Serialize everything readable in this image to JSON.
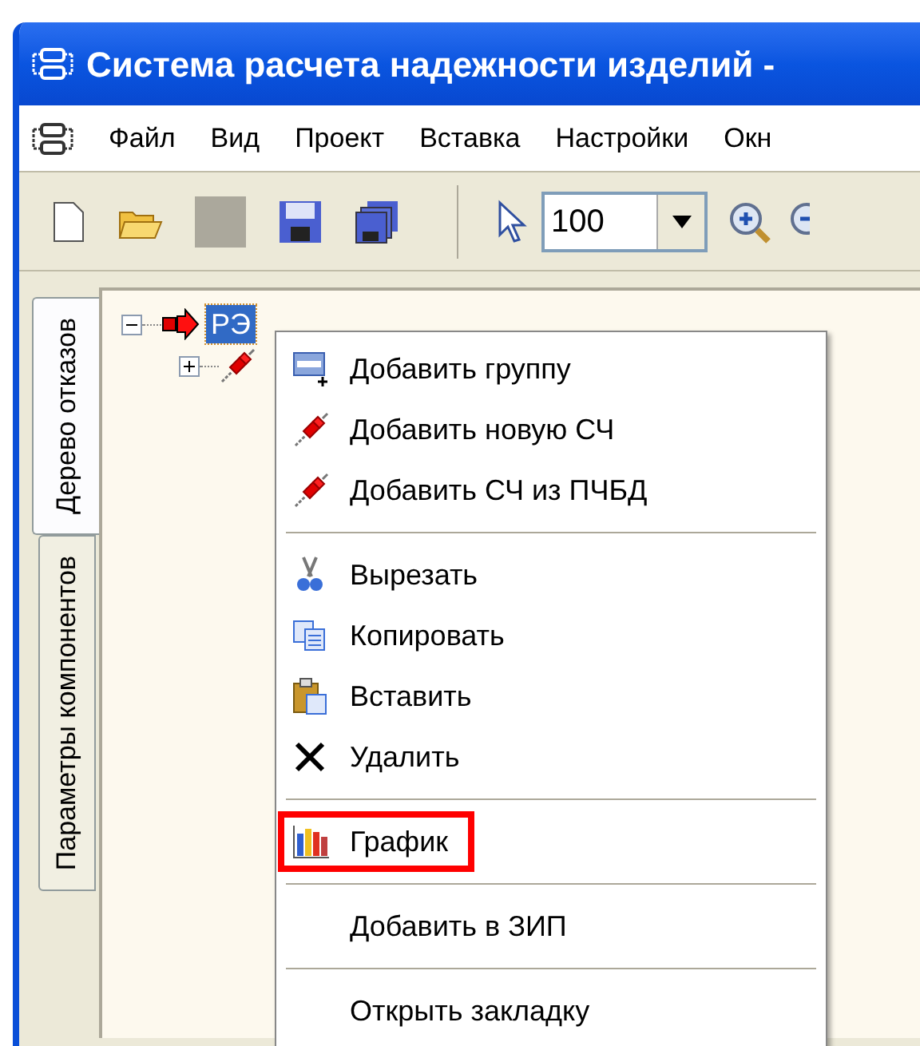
{
  "window": {
    "title": "Система расчета надежности изделий -"
  },
  "menu_bar": [
    "Файл",
    "Вид",
    "Проект",
    "Вставка",
    "Настройки",
    "Окн"
  ],
  "toolbar": {
    "zoom_value": "100"
  },
  "side_tabs": [
    {
      "label": "Дерево отказов",
      "selected": true
    },
    {
      "label": "Параметры компонентов",
      "selected": false
    }
  ],
  "tree": [
    {
      "label": "РЭ",
      "selected": true,
      "expanded": true,
      "children": [
        {
          "expanded": false
        }
      ]
    }
  ],
  "context_menu": {
    "groups": [
      [
        {
          "label": "Добавить группу",
          "highlighted": false
        },
        {
          "label": "Добавить новую СЧ",
          "highlighted": false
        },
        {
          "label": "Добавить СЧ из ПЧБД",
          "highlighted": false
        }
      ],
      [
        {
          "label": "Вырезать",
          "highlighted": false
        },
        {
          "label": "Копировать",
          "highlighted": false
        },
        {
          "label": "Вставить",
          "highlighted": false
        },
        {
          "label": "Удалить",
          "highlighted": false
        }
      ],
      [
        {
          "label": "График",
          "highlighted": true
        }
      ],
      [
        {
          "label": "Добавить в ЗИП",
          "highlighted": false
        }
      ],
      [
        {
          "label": "Открыть закладку",
          "highlighted": false
        }
      ]
    ]
  }
}
